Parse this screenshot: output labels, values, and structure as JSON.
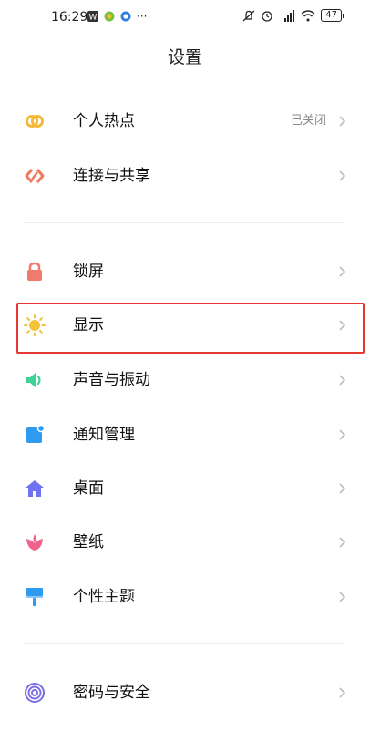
{
  "status_bar": {
    "time": "16:29",
    "more": "···",
    "battery": "47"
  },
  "page_title": "设置",
  "groups": [
    {
      "items": [
        {
          "label": "个人热点",
          "value": "已关闭",
          "icon": "hotspot-icon",
          "color": "#F5B93A"
        },
        {
          "label": "连接与共享",
          "icon": "share-icon",
          "color": "#F07A5F"
        }
      ]
    },
    {
      "items": [
        {
          "label": "锁屏",
          "icon": "lock-icon",
          "color": "#F07A6B"
        },
        {
          "label": "显示",
          "icon": "sun-icon",
          "color": "#F5C33B",
          "highlighted": true
        },
        {
          "label": "声音与振动",
          "icon": "speaker-icon",
          "color": "#3ED19A"
        },
        {
          "label": "通知管理",
          "icon": "notification-icon",
          "color": "#2F9BF0"
        },
        {
          "label": "桌面",
          "icon": "home-icon",
          "color": "#6E73F2"
        },
        {
          "label": "壁纸",
          "icon": "flower-icon",
          "color": "#F0628A"
        },
        {
          "label": "个性主题",
          "icon": "brush-icon",
          "color": "#2F9BF0"
        }
      ]
    },
    {
      "items": [
        {
          "label": "密码与安全",
          "icon": "fingerprint-icon",
          "color": "#7B6FE8"
        }
      ]
    }
  ],
  "highlight_color": "#E53935"
}
